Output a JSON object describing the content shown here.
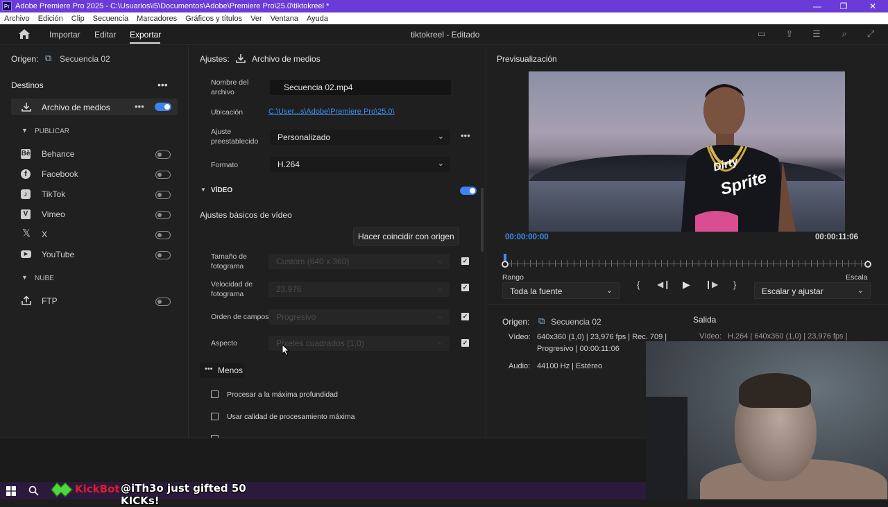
{
  "window": {
    "app_badge": "Pr",
    "title": "Adobe Premiere Pro 2025 - C:\\Usuarios\\i5\\Documentos\\Adobe\\Premiere Pro\\25.0\\tiktokreel *",
    "minimize": "—",
    "maximize": "❐",
    "close": "✕"
  },
  "menu": [
    "Archivo",
    "Edición",
    "Clip",
    "Secuencia",
    "Marcadores",
    "Gráficos y títulos",
    "Ver",
    "Ventana",
    "Ayuda"
  ],
  "workspace": {
    "tabs": [
      "Importar",
      "Editar",
      "Exportar"
    ],
    "active_tab": "Exportar",
    "document": "tiktokreel - Editado"
  },
  "source": {
    "label": "Origen:",
    "sequence": "Secuencia 02"
  },
  "destinations": {
    "title": "Destinos",
    "media_file": "Archivo de medios",
    "publish_header": "PUBLICAR",
    "publish": [
      {
        "name": "Behance",
        "icon": "behance-icon",
        "glyph": "Bē"
      },
      {
        "name": "Facebook",
        "icon": "facebook-icon",
        "glyph": "f"
      },
      {
        "name": "TikTok",
        "icon": "tiktok-icon",
        "glyph": "♪"
      },
      {
        "name": "Vimeo",
        "icon": "vimeo-icon",
        "glyph": "V"
      },
      {
        "name": "X",
        "icon": "x-icon",
        "glyph": "𝕏"
      },
      {
        "name": "YouTube",
        "icon": "youtube-icon",
        "glyph": "▶"
      }
    ],
    "cloud_header": "NUBE",
    "cloud": [
      {
        "name": "FTP",
        "icon": "ftp-upload-icon",
        "glyph": "⇪"
      }
    ]
  },
  "settings": {
    "header_label": "Ajustes:",
    "header_value": "Archivo de medios",
    "filename_label": "Nombre del archivo",
    "filename": "Secuencia 02.mp4",
    "location_label": "Ubicación",
    "location": "C:\\User...s\\Adobe\\Premiere Pro\\25.0\\",
    "preset_label": "Ajuste preestablecido",
    "preset": "Personalizado",
    "format_label": "Formato",
    "format": "H.264",
    "video_section": "VÍDEO",
    "basic_video": "Ajustes básicos de vídeo",
    "match_source": "Hacer coincidir con origen",
    "frame_size_label": "Tamaño de fotograma",
    "frame_size": "Custom (640 x 360)",
    "frame_rate_label": "Velocidad de fotograma",
    "frame_rate": "23,976",
    "field_order_label": "Orden de campos",
    "field_order": "Progresivo",
    "aspect_label": "Aspecto",
    "aspect": "Píxeles cuadrados (1,0)",
    "less": "Menos",
    "max_depth": "Procesar a la máxima profundidad",
    "max_quality": "Usar calidad de procesamiento máxima"
  },
  "preview": {
    "title": "Previsualización",
    "timecode_start": "00:00:00:00",
    "timecode_end": "00:00:11:06",
    "range_label": "Rango",
    "range": "Toda la fuente",
    "scale_label": "Escala",
    "scale": "Escalar y ajustar",
    "shirt_text_1": "Dirty",
    "shirt_text_2": "Sprite"
  },
  "summary": {
    "source_label": "Origen:",
    "source_seq": "Secuencia 02",
    "output_label": "Salida",
    "video_label": "Vídeo:",
    "video_line1": "640x360 (1,0)  |  23,976 fps  |  Rec. 709  |",
    "video_line2": "Progresivo  |  00:00:11:06",
    "audio_label": "Audio:",
    "audio": "44100 Hz  |  Estéreo",
    "output_video_label": "Vídeo:",
    "output_video": "H.264  |  640x360 (1,0)  |  23,976 fps  |"
  },
  "taskbar": {
    "kick_name": "KickBot",
    "kick_message": "@iTh3o just gifted 50 KICKs!"
  }
}
